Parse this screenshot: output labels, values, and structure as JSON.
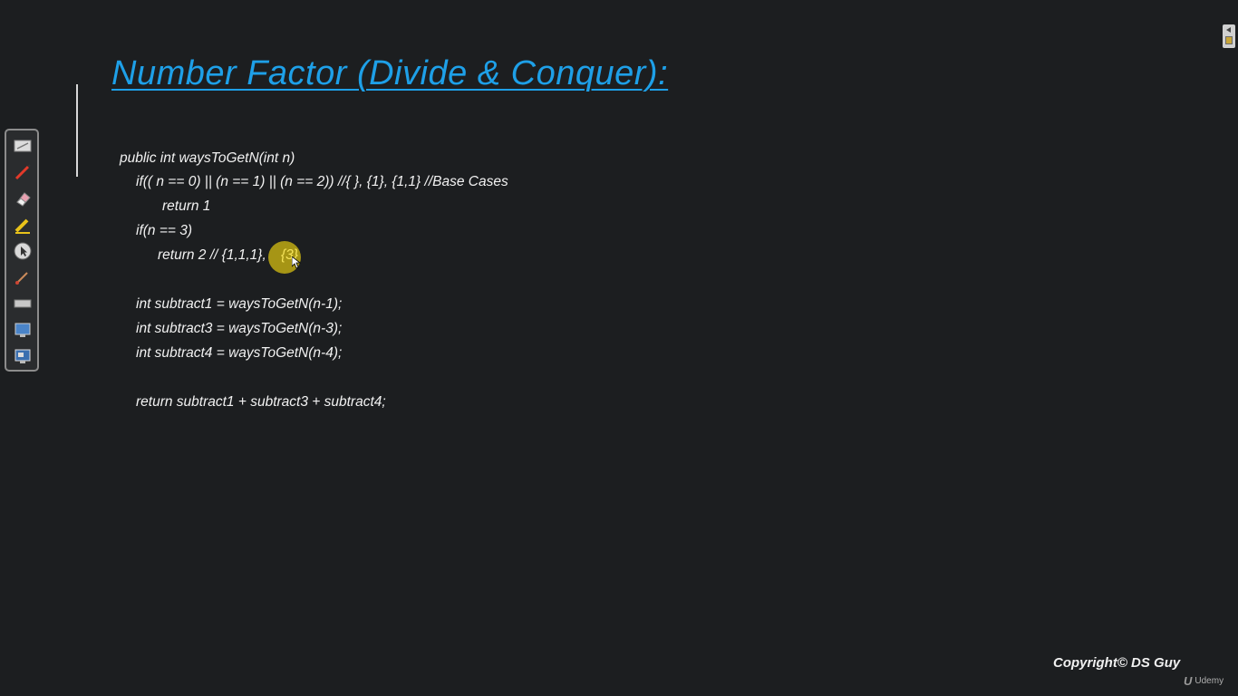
{
  "slide": {
    "title": "Number Factor (Divide & Conquer):",
    "code_lines": [
      "public int waysToGetN(int n)",
      "if(( n == 0) || (n == 1) || (n == 2)) //{ }, {1}, {1,1} //Base Cases",
      "return 1",
      "if(n == 3)",
      "return 2 // {1,1,1},",
      "{3}",
      "int subtract1 = waysToGetN(n-1);",
      "int subtract3 = waysToGetN(n-3);",
      "int subtract4 = waysToGetN(n-4);",
      "return subtract1 + subtract3 + subtract4;"
    ],
    "highlight_color": "#bea914",
    "title_color": "#1ea0e8"
  },
  "toolbar": {
    "tools": [
      "slide-view-icon",
      "pen-icon",
      "eraser-icon",
      "highlighter-icon",
      "pointer-icon",
      "laser-icon",
      "blank-screen-icon",
      "screen-icon",
      "monitor-icon"
    ]
  },
  "footer": {
    "copyright": "Copyright© DS Guy",
    "brand_logo": "U",
    "brand_name": "Udemy"
  }
}
